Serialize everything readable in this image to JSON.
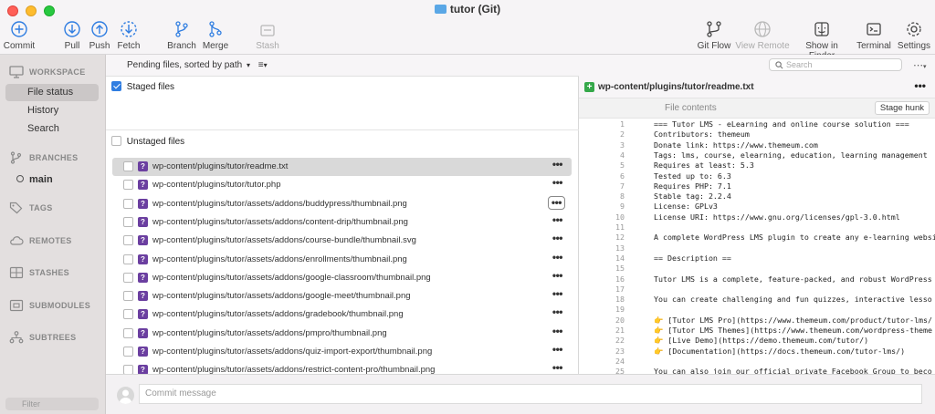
{
  "window": {
    "title": "tutor (Git)"
  },
  "toolbar": {
    "commit": "Commit",
    "pull": "Pull",
    "push": "Push",
    "fetch": "Fetch",
    "branch": "Branch",
    "merge": "Merge",
    "stash": "Stash",
    "git_flow": "Git Flow",
    "view_remote": "View Remote",
    "show_in_finder": "Show in Finder",
    "terminal": "Terminal",
    "settings": "Settings"
  },
  "sidebar": {
    "workspace": "WORKSPACE",
    "items": [
      "File status",
      "History",
      "Search"
    ],
    "branches": "BRANCHES",
    "branch_main": "main",
    "tags": "TAGS",
    "remotes": "REMOTES",
    "stashes": "STASHES",
    "submodules": "SUBMODULES",
    "subtrees": "SUBTREES",
    "filter_placeholder": "Filter"
  },
  "files": {
    "sort_label": "Pending files, sorted by path",
    "staged_label": "Staged files",
    "unstaged_label": "Unstaged files",
    "unstaged": [
      "wp-content/plugins/tutor/readme.txt",
      "wp-content/plugins/tutor/tutor.php",
      "wp-content/plugins/tutor/assets/addons/buddypress/thumbnail.png",
      "wp-content/plugins/tutor/assets/addons/content-drip/thumbnail.png",
      "wp-content/plugins/tutor/assets/addons/course-bundle/thumbnail.svg",
      "wp-content/plugins/tutor/assets/addons/enrollments/thumbnail.png",
      "wp-content/plugins/tutor/assets/addons/google-classroom/thumbnail.png",
      "wp-content/plugins/tutor/assets/addons/google-meet/thumbnail.png",
      "wp-content/plugins/tutor/assets/addons/gradebook/thumbnail.png",
      "wp-content/plugins/tutor/assets/addons/pmpro/thumbnail.png",
      "wp-content/plugins/tutor/assets/addons/quiz-import-export/thumbnail.png",
      "wp-content/plugins/tutor/assets/addons/restrict-content-pro/thumbnail.png"
    ],
    "status_glyph": "?",
    "more_glyph": "•••"
  },
  "search": {
    "placeholder": "Search"
  },
  "diff": {
    "file": "wp-content/plugins/tutor/readme.txt",
    "contents_label": "File contents",
    "stage_hunk": "Stage hunk",
    "more_glyph": "•••",
    "lines": [
      "=== Tutor LMS - eLearning and online course solution ===",
      "Contributors: themeum",
      "Donate link: https://www.themeum.com",
      "Tags: lms, course, elearning, education, learning management",
      "Requires at least: 5.3",
      "Tested up to: 6.3",
      "Requires PHP: 7.1",
      "Stable tag: 2.2.4",
      "License: GPLv3",
      "License URI: https://www.gnu.org/licenses/gpl-3.0.html",
      "",
      "A complete WordPress LMS plugin to create any e-learning websi",
      "",
      "== Description ==",
      "",
      "Tutor LMS is a complete, feature-packed, and robust WordPress",
      "",
      "You can create challenging and fun quizzes, interactive lesso",
      "",
      "👉 [Tutor LMS Pro](https://www.themeum.com/product/tutor-lms/",
      "👉 [Tutor LMS Themes](https://www.themeum.com/wordpress-theme",
      "👉 [Live Demo](https://demo.themeum.com/tutor/)",
      "👉 [Documentation](https://docs.themeum.com/tutor-lms/)",
      "",
      "You can also join our official private Facebook Group to beco"
    ]
  },
  "commit": {
    "placeholder": "Commit message"
  },
  "colors": {
    "accent": "#2f7de1",
    "status_unknown": "#6b3fa0",
    "added": "#35a84a"
  }
}
